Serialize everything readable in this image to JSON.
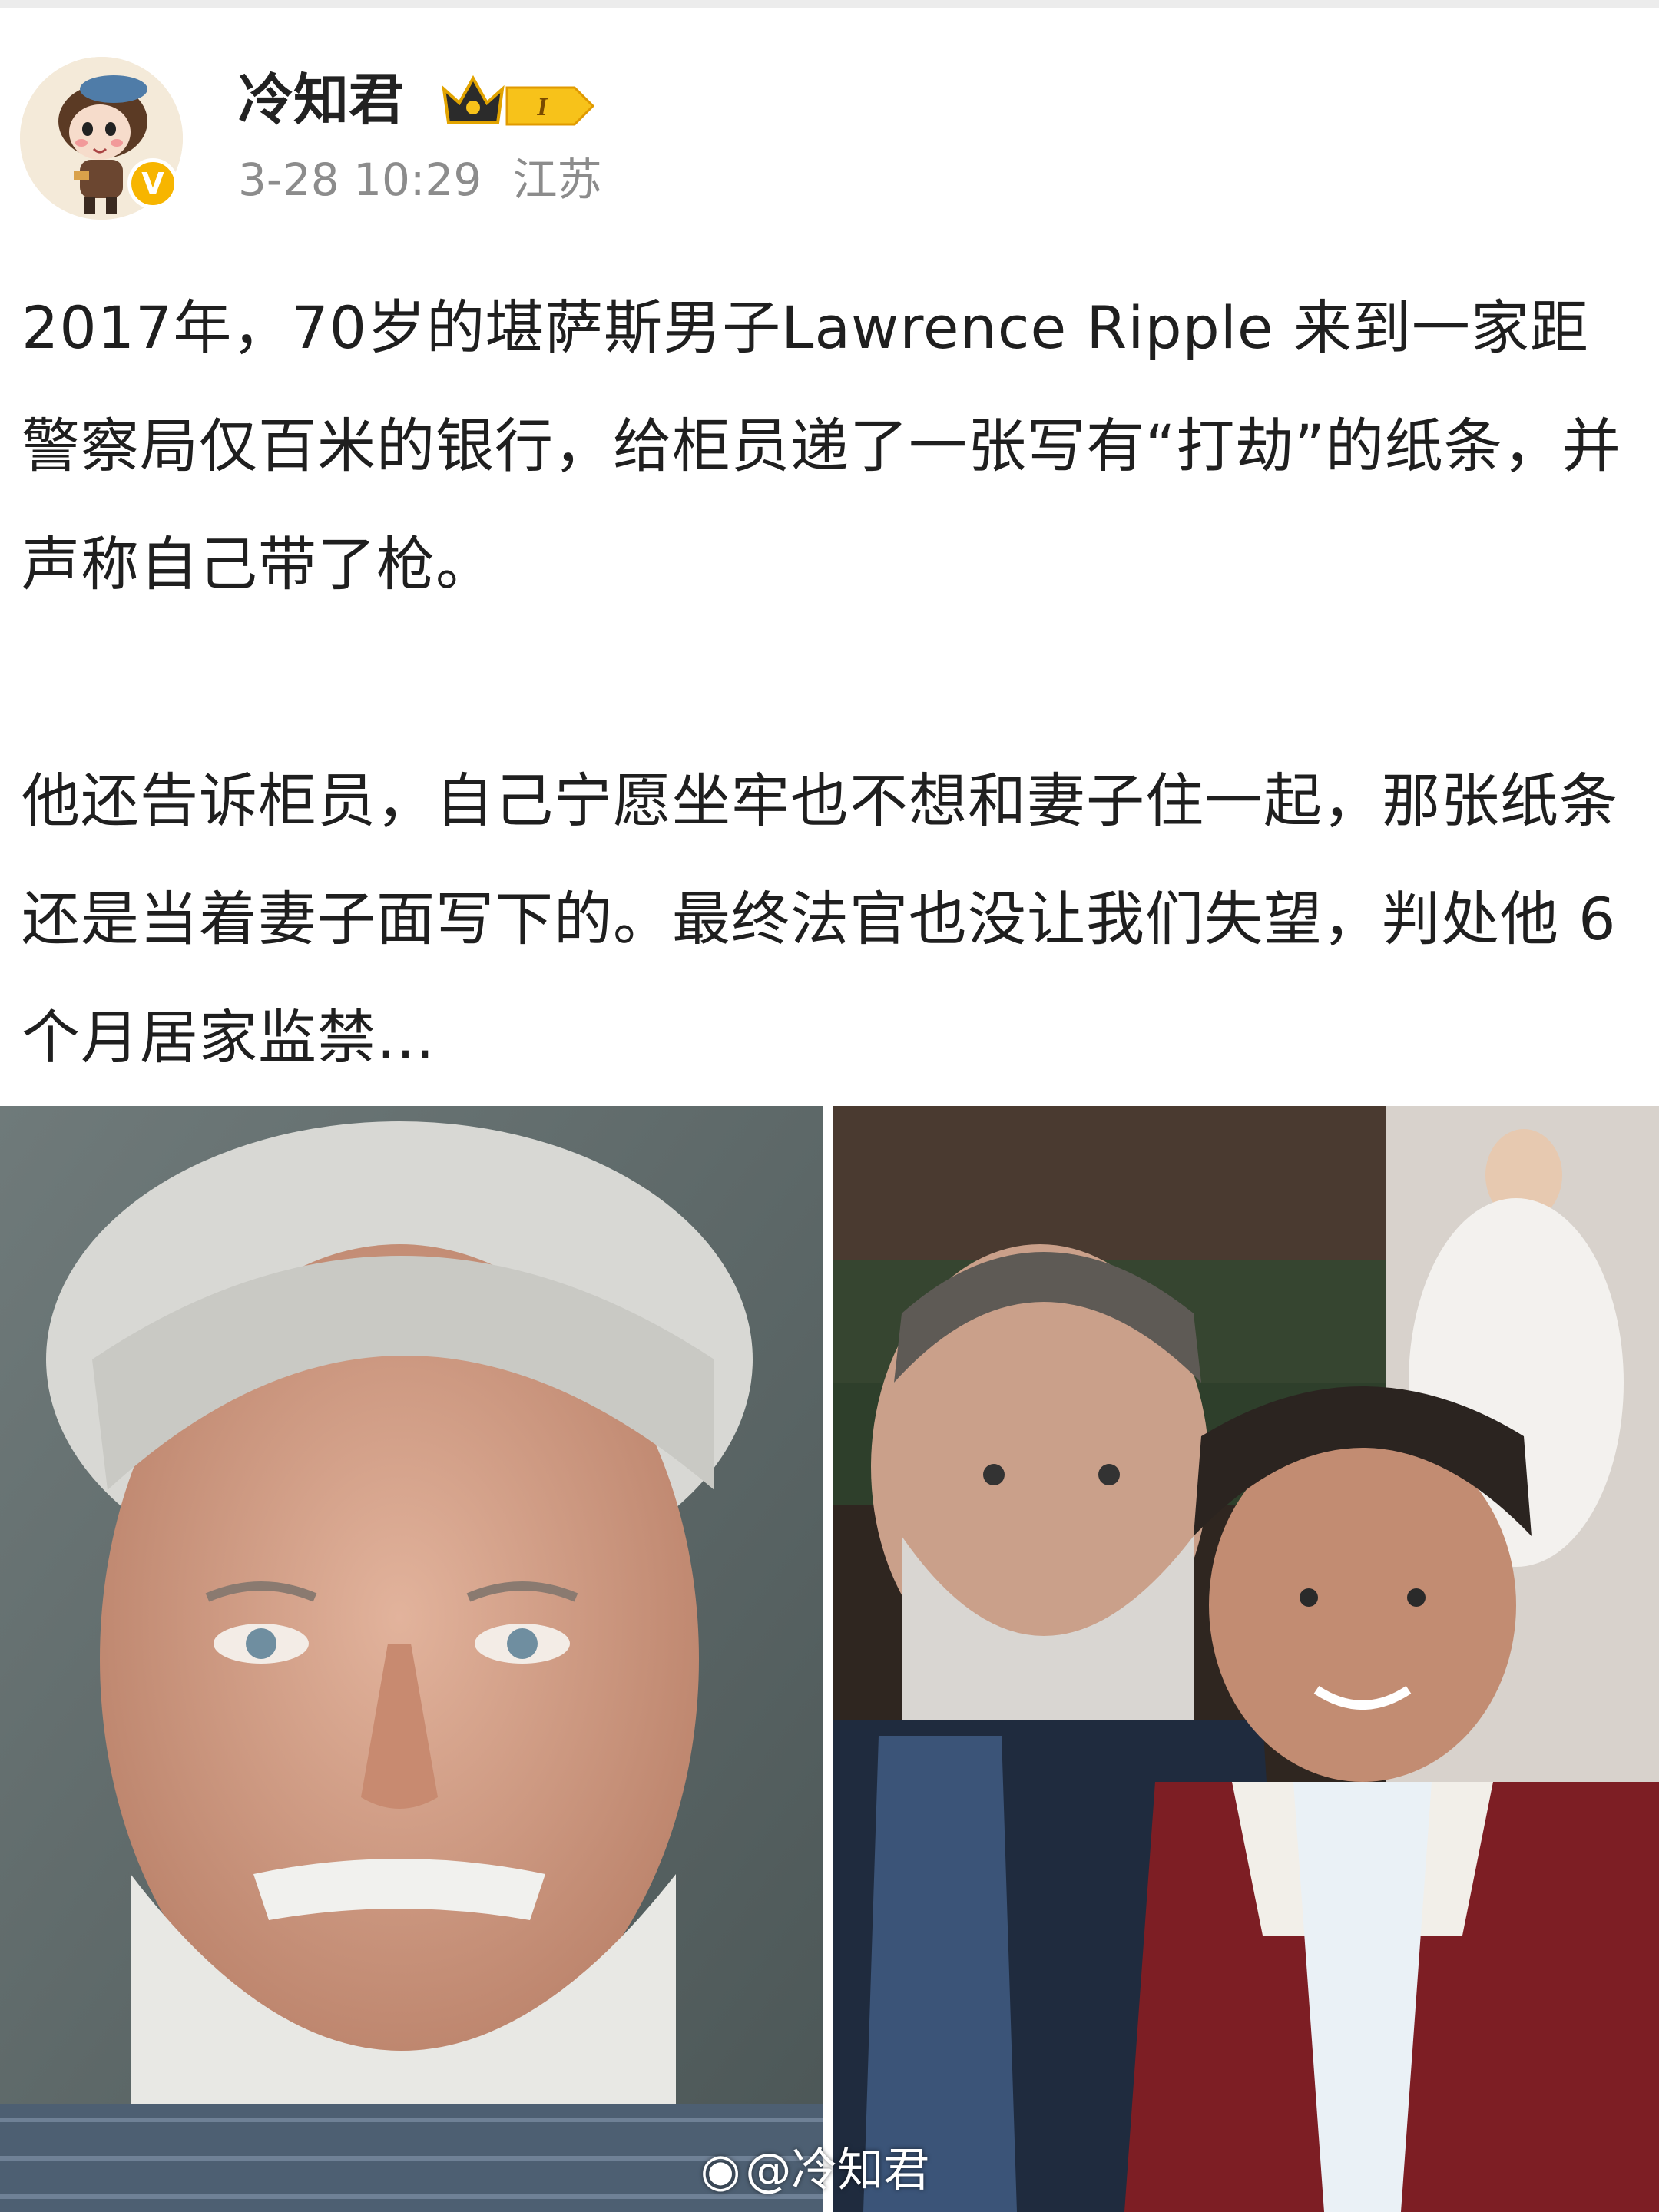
{
  "post": {
    "username": "冷知君",
    "level_badge": "I",
    "timestamp": "3-28 10:29",
    "location": "江苏",
    "paragraphs": [
      "2017年，70岁的堪萨斯男子Lawrence Ripple 来到一家距警察局仅百米的银行，给柜员递了一张写有“打劫”的纸条，并声称自己带了枪。",
      "他还告诉柜员，自己宁愿坐牢也不想和妻子住一起，那张纸条还是当着妻子面写下的。最终法官也没让我们失望，判处他 6个月居家监禁…"
    ],
    "watermark": "@冷知君"
  },
  "icons": {
    "avatar": "cartoon-girl-avatar",
    "verified": "verified-v-icon",
    "level": "crown-level-badge-icon",
    "weibo": "weibo-logo-icon"
  },
  "colors": {
    "verified": "#f7b500",
    "meta_text": "#8c8c8c"
  }
}
